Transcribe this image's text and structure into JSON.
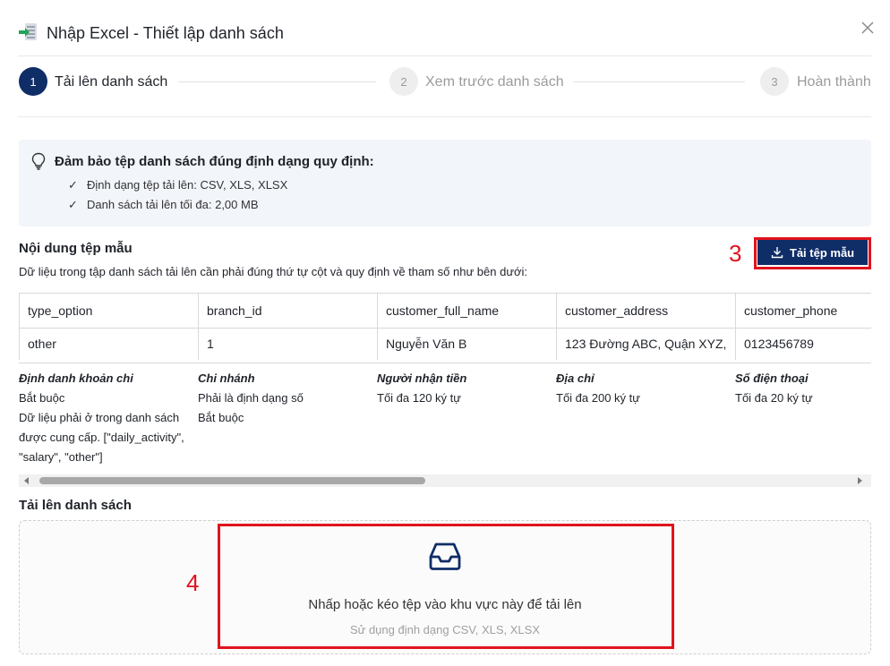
{
  "dialog": {
    "title": "Nhập Excel - Thiết lập danh sách"
  },
  "steps": [
    {
      "number": "1",
      "label": "Tải lên danh sách"
    },
    {
      "number": "2",
      "label": "Xem trước danh sách"
    },
    {
      "number": "3",
      "label": "Hoàn thành"
    }
  ],
  "info": {
    "title": "Đảm bảo tệp danh sách đúng định dạng quy định:",
    "check_mark": "✓",
    "lines": [
      "Định dạng tệp tải lên: CSV, XLS, XLSX",
      "Danh sách tải lên tối đa: 2,00 MB"
    ]
  },
  "sample": {
    "title": "Nội dung tệp mẫu",
    "description": "Dữ liệu trong tập danh sách tải lên cần phải đúng thứ tự cột và quy định về tham số như bên dưới:",
    "download_label": "Tải tệp mẫu",
    "columns": [
      "type_option",
      "branch_id",
      "customer_full_name",
      "customer_address",
      "customer_phone"
    ],
    "row": [
      "other",
      "1",
      "Nguyễn Văn B",
      "123 Đường ABC, Quận XYZ,",
      "0123456789"
    ],
    "details": [
      {
        "heading": "Định danh khoản chi",
        "lines": [
          "Bắt buộc",
          "Dữ liệu phải ở trong danh sách",
          "được cung cấp. [\"daily_activity\",",
          "\"salary\", \"other\"]"
        ]
      },
      {
        "heading": "Chi nhánh",
        "lines": [
          "Phải là định dạng số",
          "Bắt buộc"
        ]
      },
      {
        "heading": "Người nhận tiền",
        "lines": [
          "Tối đa 120 ký tự"
        ]
      },
      {
        "heading": "Địa chỉ",
        "lines": [
          "Tối đa 200 ký tự"
        ]
      },
      {
        "heading": "Số điện thoại",
        "lines": [
          "Tối đa 20 ký tự"
        ]
      }
    ]
  },
  "upload": {
    "title": "Tải lên danh sách",
    "hint": "Nhấp hoặc kéo tệp vào khu vực này để tải lên",
    "formats": "Sử dụng định dạng CSV, XLS, XLSX"
  },
  "annotations": {
    "marker_download": "3",
    "marker_upload": "4"
  },
  "colors": {
    "primary": "#0f2d67",
    "annotation_red": "#e0141e",
    "info_bg": "#f2f5fa"
  },
  "icons": {
    "header": "excel-import-icon",
    "close": "close-icon",
    "bulb": "lightbulb-icon",
    "download": "download-icon",
    "upload": "inbox-icon"
  }
}
